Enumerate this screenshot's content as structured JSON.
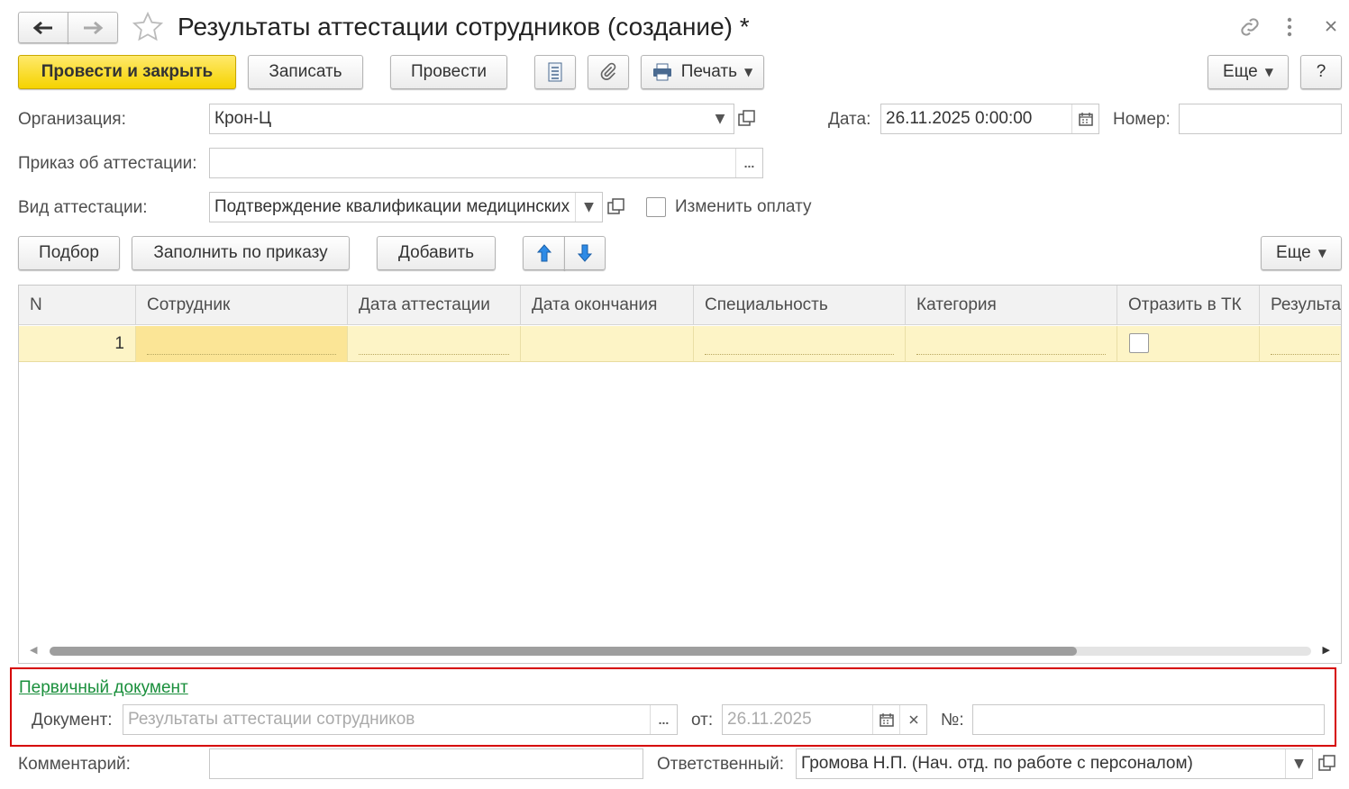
{
  "window": {
    "title": "Результаты аттестации сотрудников (создание) *",
    "nav_back_icon": "arrow-left-icon",
    "nav_forward_icon": "arrow-right-icon",
    "favorite_icon": "star-icon",
    "link_icon": "link-icon",
    "more_icon": "vertical-dots-icon",
    "close_icon": "close-icon"
  },
  "toolbar": {
    "post_and_close": "Провести и закрыть",
    "save": "Записать",
    "post": "Провести",
    "print": "Печать",
    "more": "Еще",
    "help": "?"
  },
  "form": {
    "org_label": "Организация:",
    "org_value": "Крон-Ц",
    "date_label": "Дата:",
    "date_value": "26.11.2025  0:00:00",
    "number_label": "Номер:",
    "number_value": "",
    "order_label": "Приказ об аттестации:",
    "order_value": "",
    "kind_label": "Вид аттестации:",
    "kind_value": "Подтверждение квалификации медицинских",
    "change_pay_label": "Изменить оплату",
    "change_pay_checked": false
  },
  "table_toolbar": {
    "pick": "Подбор",
    "fill_by_order": "Заполнить по приказу",
    "add": "Добавить",
    "more": "Еще"
  },
  "table": {
    "columns": [
      "N",
      "Сотрудник",
      "Дата аттестации",
      "Дата окончания",
      "Специальность",
      "Категория",
      "Отразить в ТК",
      "Результат"
    ],
    "rows": [
      {
        "n": "1",
        "employee": "",
        "attest_date": "",
        "end_date": "",
        "specialty": "",
        "category": "",
        "reflect_tk": false,
        "result": ""
      }
    ]
  },
  "primary_doc": {
    "link": "Первичный документ",
    "doc_label": "Документ:",
    "doc_placeholder": "Результаты аттестации сотрудников",
    "from_label": "от:",
    "from_placeholder": "26.11.2025",
    "no_label": "№:",
    "no_value": ""
  },
  "footer": {
    "comment_label": "Комментарий:",
    "comment_value": "",
    "responsible_label": "Ответственный:",
    "responsible_value": "Громова Н.П. (Нач. отд. по работе с персоналом)"
  },
  "colors": {
    "accent_yellow": "#f5d300",
    "row_highlight": "#fdf4c6",
    "link_green": "#1a8f3c",
    "highlight_red": "#d60000"
  }
}
